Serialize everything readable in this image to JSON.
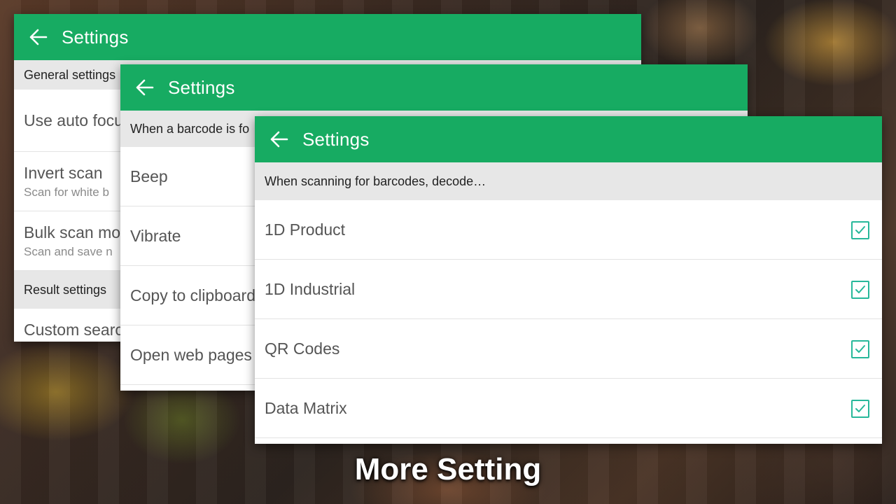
{
  "caption": "More Setting",
  "colors": {
    "appbar": "#17ab62",
    "checkbox": "#27b89a",
    "section_header_bg": "#e7e7e7"
  },
  "panel1": {
    "title": "Settings",
    "back_icon": "arrow-left-icon",
    "section_general": "General settings",
    "rows": [
      {
        "title": "Use auto focus",
        "subtitle": ""
      },
      {
        "title": "Invert scan",
        "subtitle": "Scan for white b"
      },
      {
        "title": "Bulk scan mo",
        "subtitle": "Scan and save n"
      }
    ],
    "section_result": "Result settings",
    "last_row": "Custom search"
  },
  "panel2": {
    "title": "Settings",
    "back_icon": "arrow-left-icon",
    "section": "When a barcode is fo",
    "rows": [
      "Beep",
      "Vibrate",
      "Copy to clipboard",
      "Open web pages"
    ]
  },
  "panel3": {
    "title": "Settings",
    "back_icon": "arrow-left-icon",
    "section": "When scanning for barcodes, decode…",
    "rows": [
      {
        "label": "1D Product",
        "checked": true
      },
      {
        "label": "1D Industrial",
        "checked": true
      },
      {
        "label": "QR Codes",
        "checked": true
      },
      {
        "label": "Data Matrix",
        "checked": true
      }
    ]
  }
}
